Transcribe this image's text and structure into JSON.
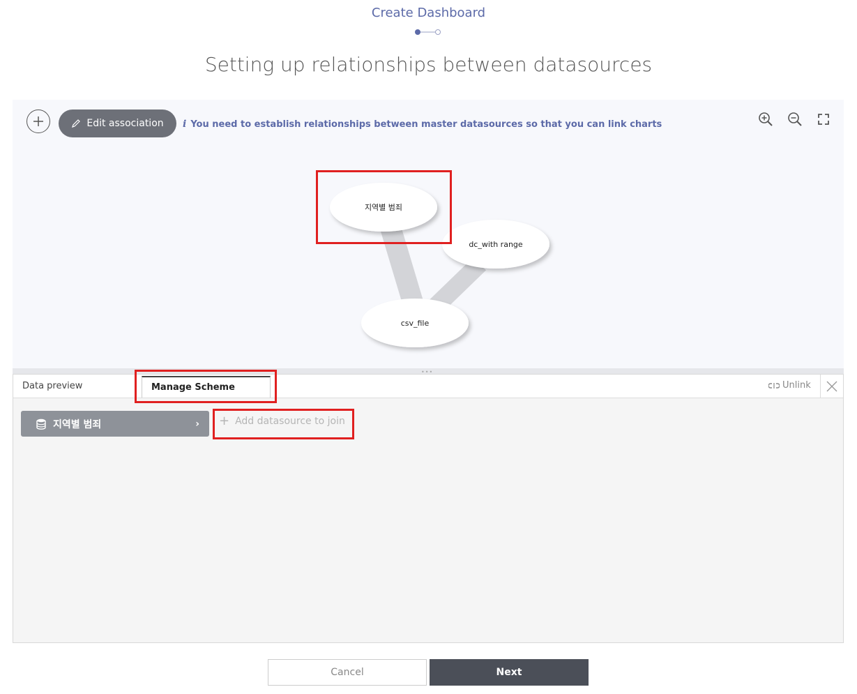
{
  "header": {
    "title": "Create Dashboard",
    "step_current": 1,
    "step_total": 2
  },
  "page_title": "Setting up relationships between datasources",
  "toolbar": {
    "add_icon": "plus-circle-icon",
    "edit_label": "Edit association",
    "edit_icon": "pencil-icon",
    "hint_icon": "info-icon",
    "hint_text": "You need to establish relationships between master datasources so that you can link charts",
    "zoom_in_icon": "zoom-in-icon",
    "zoom_out_icon": "zoom-out-icon",
    "fit_icon": "fullscreen-icon"
  },
  "graph": {
    "nodes": [
      {
        "id": "n1",
        "label": "지역별 범죄"
      },
      {
        "id": "n2",
        "label": "dc_with range"
      },
      {
        "id": "n3",
        "label": "csv_file"
      }
    ],
    "edges": [
      [
        "n1",
        "n3"
      ],
      [
        "n2",
        "n3"
      ]
    ]
  },
  "panel": {
    "tabs": [
      {
        "label": "Data preview"
      },
      {
        "label": "Manage Scheme",
        "active": true
      }
    ],
    "unlink_label": "Unlink",
    "close_icon": "close-icon",
    "datasource_chip": {
      "label": "지역별 범죄",
      "icon": "database-icon"
    },
    "add_join_label": "Add datasource to join"
  },
  "footer": {
    "cancel_label": "Cancel",
    "next_label": "Next"
  },
  "colors": {
    "accent": "#5c6aa8",
    "highlight": "#e02020",
    "primary_button": "#4b4f58"
  }
}
